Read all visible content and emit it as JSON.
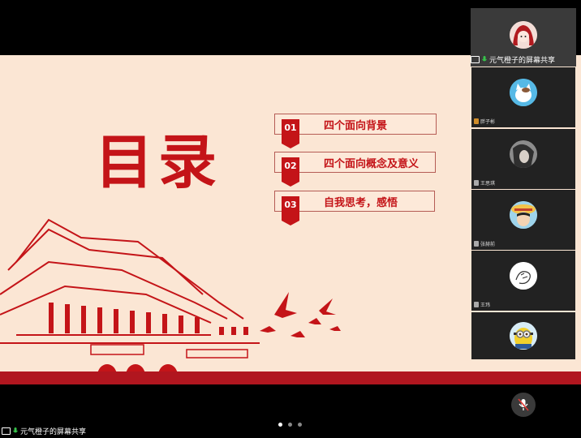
{
  "slide": {
    "title": "目录",
    "toc": [
      {
        "num": "01",
        "text": "四个面向背景"
      },
      {
        "num": "02",
        "text": "四个面向概念及意义"
      },
      {
        "num": "03",
        "text": "自我思考，感悟"
      }
    ]
  },
  "share_thumbnail": {
    "label": "元气橙子的屏幕共享"
  },
  "participants": [
    {
      "name": "胖子彬",
      "avatar": "cat-avatar-icon"
    },
    {
      "name": "王思琪",
      "avatar": "photo-avatar-icon"
    },
    {
      "name": "张赫前",
      "avatar": "anime-avatar-icon"
    },
    {
      "name": "王玮",
      "avatar": "sketch-avatar-icon"
    },
    {
      "name": "",
      "avatar": "minion-avatar-icon"
    }
  ],
  "bottom_bar": {
    "share_label": "元气橙子的屏幕共享",
    "page_dots": {
      "count": 3,
      "active": 0
    }
  },
  "colors": {
    "accent": "#c41418",
    "slide_bg": "#fbe6d4",
    "mic_green": "#36c24a"
  }
}
